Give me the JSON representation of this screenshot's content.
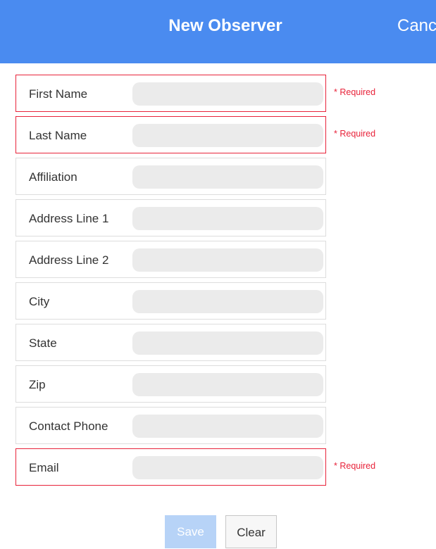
{
  "header": {
    "title": "New Observer",
    "cancel_label": "Cancel"
  },
  "form": {
    "required_text": "* Required",
    "fields": [
      {
        "label": "First Name",
        "value": "",
        "required": true
      },
      {
        "label": "Last Name",
        "value": "",
        "required": true
      },
      {
        "label": "Affiliation",
        "value": "",
        "required": false
      },
      {
        "label": "Address Line 1",
        "value": "",
        "required": false
      },
      {
        "label": "Address Line 2",
        "value": "",
        "required": false
      },
      {
        "label": "City",
        "value": "",
        "required": false
      },
      {
        "label": "State",
        "value": "",
        "required": false
      },
      {
        "label": "Zip",
        "value": "",
        "required": false
      },
      {
        "label": "Contact Phone",
        "value": "",
        "required": false
      },
      {
        "label": "Email",
        "value": "",
        "required": true
      }
    ]
  },
  "buttons": {
    "save_label": "Save",
    "save_enabled": false,
    "clear_label": "Clear"
  },
  "colors": {
    "header_background": "#4a8bf0",
    "required_red": "#e8233a",
    "input_fill": "#ebebeb",
    "save_disabled": "#b7d3f7"
  }
}
